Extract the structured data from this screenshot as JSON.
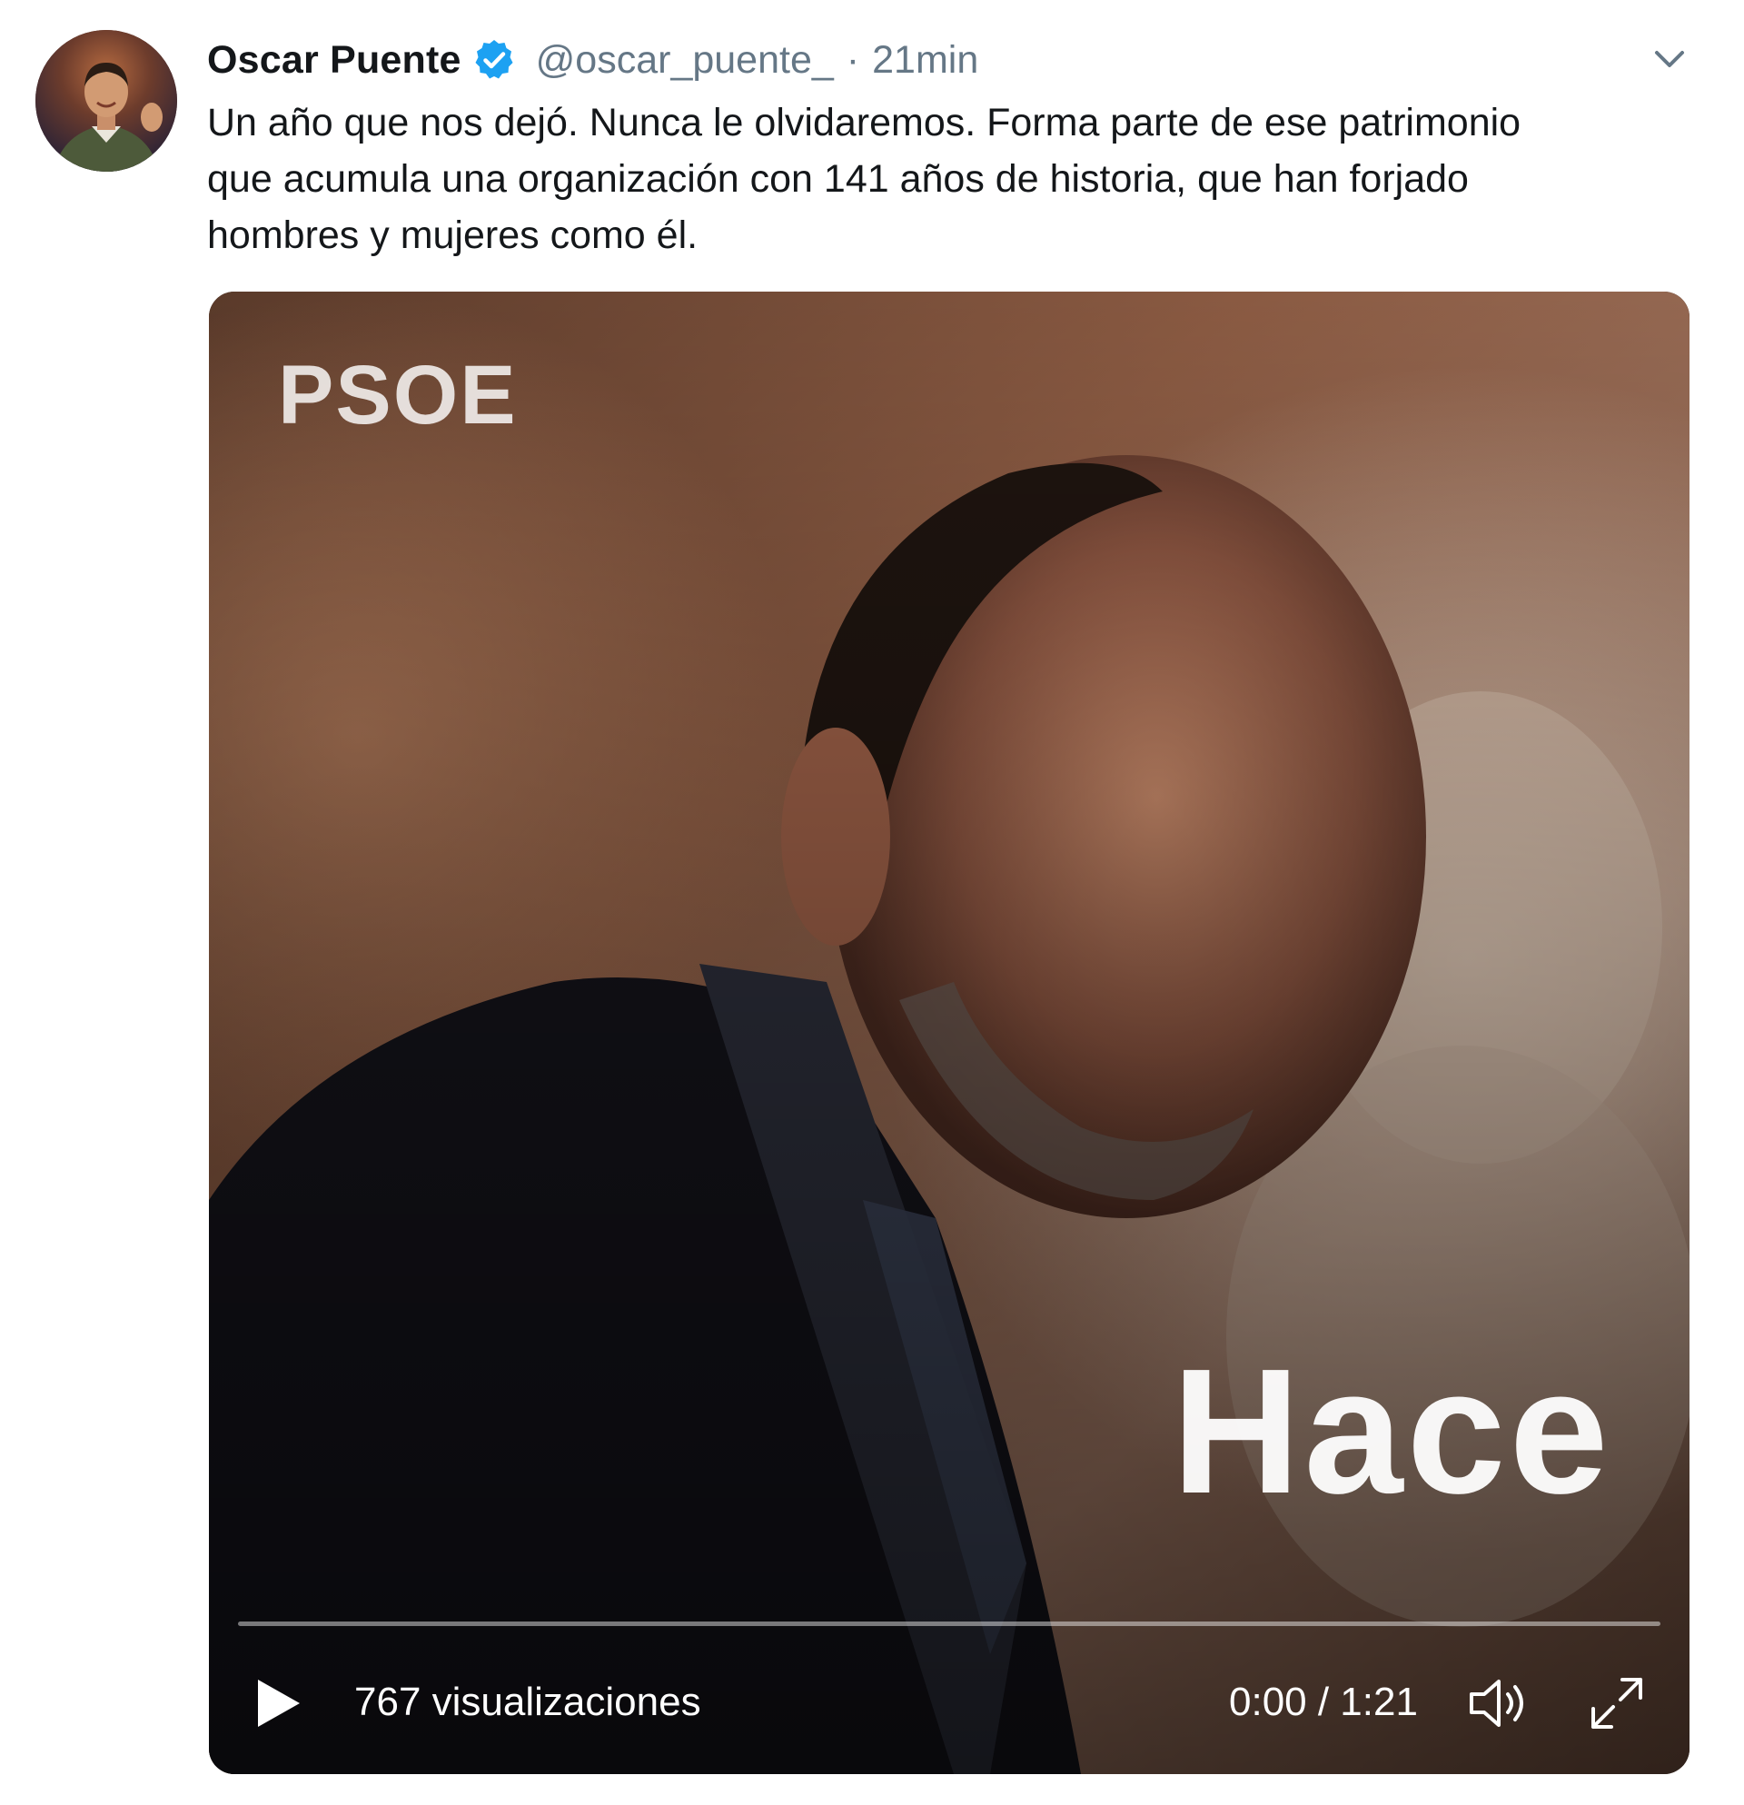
{
  "tweet": {
    "author": {
      "display_name": "Oscar Puente",
      "handle": "@oscar_puente_",
      "verified": true,
      "avatar_icon": "user-avatar"
    },
    "separator": "·",
    "timestamp": "21min",
    "menu_icon": "chevron-down-icon",
    "text_lines": [
      "Un año que nos dejó. Nunca le olvidaremos. Forma parte de ese patrimonio",
      "que acumula una organización con 141 años de historia, que han forjado",
      "hombres y mujeres como él."
    ]
  },
  "video": {
    "watermark": "PSOE",
    "overlay_caption": "Hace",
    "views": "767 visualizaciones",
    "time": "0:00 / 1:21",
    "progress": 0,
    "controls": {
      "play_icon": "play-icon",
      "volume_icon": "volume-icon",
      "fullscreen_icon": "expand-icon"
    }
  },
  "colors": {
    "text_primary": "#14171a",
    "text_secondary": "#657786",
    "verified_blue": "#1da1f2",
    "video_overlay_text": "#ffffff"
  }
}
